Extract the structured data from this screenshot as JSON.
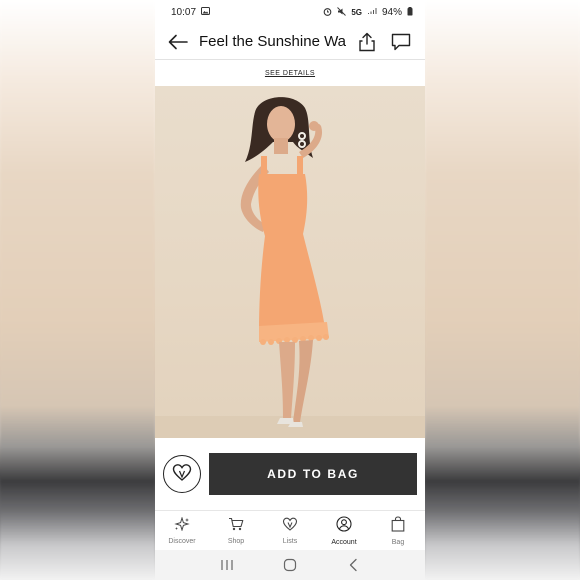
{
  "status_bar": {
    "time": "10:07",
    "network": "5G",
    "battery": "94%"
  },
  "header": {
    "title": "Feel the Sunshine Wa..",
    "back_icon": "arrow-left-icon",
    "share_icon": "share-icon",
    "chat_icon": "chat-icon"
  },
  "promo": {
    "link_label": "SEE DETAILS"
  },
  "product": {
    "dress_color": "#f4a672",
    "background_color": "#e7d8c4"
  },
  "action_bar": {
    "add_to_bag_label": "ADD TO BAG",
    "button_color": "#333333",
    "wishlist_icon": "heart-icon"
  },
  "tab_bar": {
    "items": [
      {
        "label": "Discover",
        "icon": "sparkle-icon"
      },
      {
        "label": "Shop",
        "icon": "cart-icon"
      },
      {
        "label": "Lists",
        "icon": "heart-icon"
      },
      {
        "label": "Account",
        "icon": "user-icon"
      },
      {
        "label": "Bag",
        "icon": "bag-icon"
      }
    ],
    "active_index": 3
  },
  "system_nav": {
    "recents_icon": "recents-icon",
    "home_icon": "home-icon",
    "back_icon": "back-chevron-icon"
  }
}
